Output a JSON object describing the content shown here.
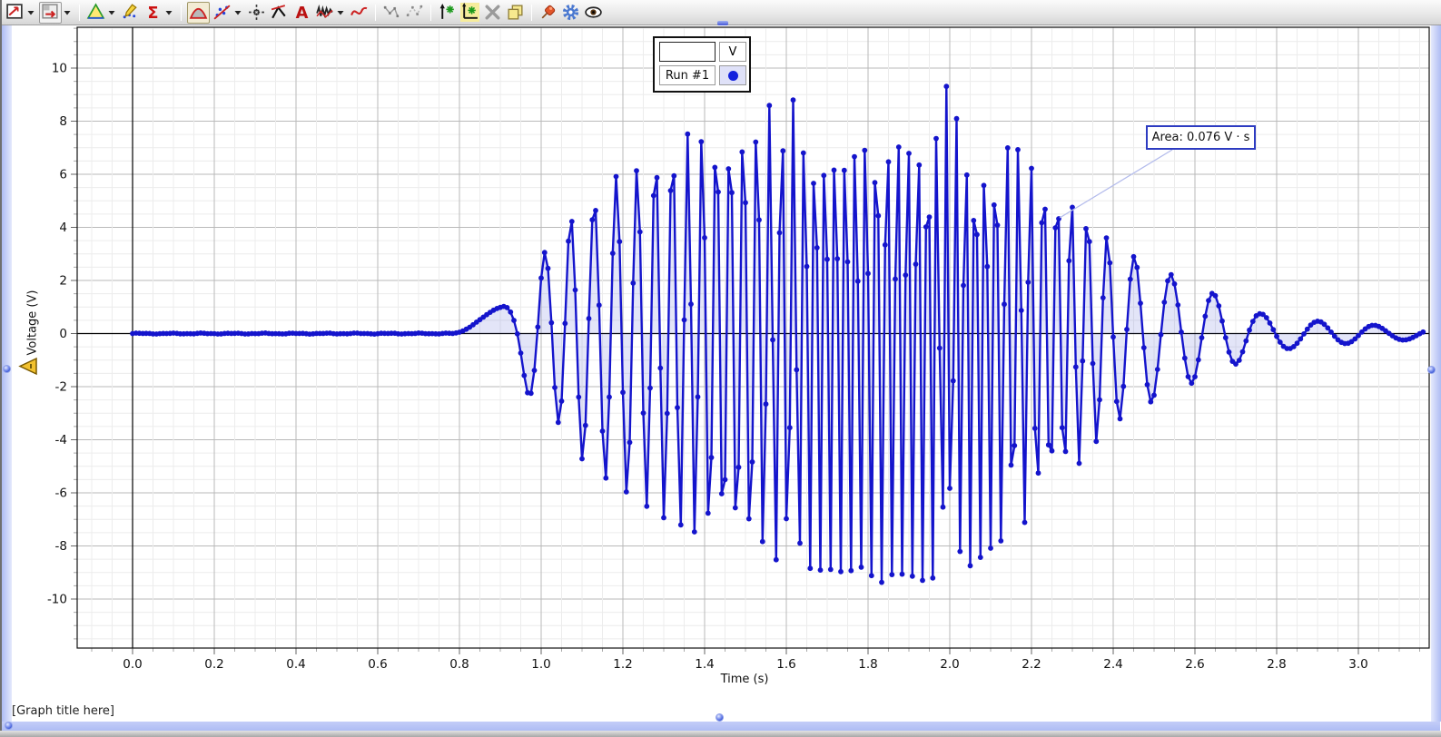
{
  "toolbar": {
    "buttons": [
      {
        "icon": "graph-display",
        "dropdown": true
      },
      {
        "icon": "scale-to-fit",
        "dropdown": true,
        "boxed": true
      },
      {
        "sep": true
      },
      {
        "icon": "prism",
        "dropdown": true
      },
      {
        "icon": "pencil-edit"
      },
      {
        "icon": "sigma",
        "dropdown": true
      },
      {
        "sep": true
      },
      {
        "icon": "area-tool",
        "active": true
      },
      {
        "icon": "curve-fit",
        "dropdown": true
      },
      {
        "icon": "smart-cursor"
      },
      {
        "icon": "tangent"
      },
      {
        "icon": "annotate"
      },
      {
        "icon": "noise-wave",
        "dropdown": true
      },
      {
        "icon": "sketch"
      },
      {
        "sep": true
      },
      {
        "icon": "link-points"
      },
      {
        "icon": "unlink-points"
      },
      {
        "sep": true
      },
      {
        "icon": "add-plot"
      },
      {
        "icon": "axes-tool",
        "highlight": true
      },
      {
        "icon": "remove-plot"
      },
      {
        "icon": "copy-display"
      },
      {
        "sep": true
      },
      {
        "icon": "pin"
      },
      {
        "icon": "settings-gear"
      },
      {
        "icon": "visibility-eye"
      }
    ]
  },
  "legend": {
    "value_header": "V",
    "run_label": "Run #1"
  },
  "annotation": {
    "text": "Area: 0.076 V · s"
  },
  "axis": {
    "x_label": "Time (s)",
    "y_label": "Voltage (V)",
    "title_placeholder": "[Graph title here]"
  },
  "chart_data": {
    "type": "line",
    "title": "",
    "xlabel": "Time (s)",
    "ylabel": "Voltage (V)",
    "series": [
      {
        "name": "Run #1",
        "color": "#1414cc",
        "marker": "dot"
      }
    ],
    "x_ticks": [
      "0.0",
      "0.2",
      "0.4",
      "0.6",
      "0.8",
      "1.0",
      "1.2",
      "1.4",
      "1.6",
      "1.8",
      "2.0",
      "2.2",
      "2.4",
      "2.6",
      "2.8",
      "3.0"
    ],
    "x_tick_values": [
      0.0,
      0.2,
      0.4,
      0.6,
      0.8,
      1.0,
      1.2,
      1.4,
      1.6,
      1.8,
      2.0,
      2.2,
      2.4,
      2.6,
      2.8,
      3.0
    ],
    "y_ticks": [
      -10,
      -8,
      -6,
      -4,
      -2,
      0,
      2,
      4,
      6,
      8,
      10
    ],
    "x_minor_step": 0.05,
    "y_minor_step": 0.5,
    "x_range": [
      -0.136,
      3.173
    ],
    "y_range": [
      -11.85,
      11.54
    ],
    "grid": true,
    "area_value_label": "Area: 0.076 V · s",
    "signal": {
      "description": "voltage burst: flat near 0 V until ~0.78 s, amplitude-modulated oscillation peaking ~9.5 V near 1.9 s, decaying ring-down to ~0.2 V by 3.16 s",
      "sample_rate_hz": 120,
      "t_start": 0.0,
      "t_end": 3.16,
      "envelope_keypoints": [
        [
          0,
          0
        ],
        [
          0.76,
          0
        ],
        [
          0.8,
          0.22
        ],
        [
          0.84,
          0.6
        ],
        [
          0.9,
          1.0
        ],
        [
          0.94,
          1.5
        ],
        [
          0.97,
          2.35
        ],
        [
          1.0,
          3.0
        ],
        [
          1.04,
          3.3
        ],
        [
          1.08,
          4.6
        ],
        [
          1.13,
          5.0
        ],
        [
          1.18,
          5.9
        ],
        [
          1.23,
          6.2
        ],
        [
          1.3,
          7.0
        ],
        [
          1.4,
          7.9
        ],
        [
          1.5,
          8.5
        ],
        [
          1.62,
          8.9
        ],
        [
          1.75,
          9.2
        ],
        [
          1.88,
          9.5
        ],
        [
          1.95,
          9.4
        ],
        [
          2.0,
          9.3
        ],
        [
          2.06,
          8.7
        ],
        [
          2.12,
          8.0
        ],
        [
          2.18,
          7.2
        ],
        [
          2.24,
          6.2
        ],
        [
          2.3,
          5.2
        ],
        [
          2.36,
          4.1
        ],
        [
          2.4,
          3.4
        ],
        [
          2.44,
          3.0
        ],
        [
          2.48,
          2.7
        ],
        [
          2.53,
          2.3
        ],
        [
          2.58,
          1.95
        ],
        [
          2.64,
          1.55
        ],
        [
          2.7,
          1.15
        ],
        [
          2.76,
          0.75
        ],
        [
          2.84,
          0.55
        ],
        [
          2.95,
          0.4
        ],
        [
          3.05,
          0.3
        ],
        [
          3.16,
          0.2
        ]
      ],
      "frequency_keypoints_hz": [
        [
          0.78,
          1.8
        ],
        [
          0.88,
          2.6
        ],
        [
          0.93,
          6
        ],
        [
          0.96,
          9.5
        ],
        [
          1.0,
          13
        ],
        [
          1.06,
          15.5
        ],
        [
          1.15,
          18
        ],
        [
          1.25,
          22
        ],
        [
          1.4,
          28
        ],
        [
          1.55,
          35
        ],
        [
          1.7,
          39.5
        ],
        [
          1.8,
          40.5
        ],
        [
          1.95,
          41.5
        ],
        [
          2.05,
          39.5
        ],
        [
          2.15,
          36
        ],
        [
          2.25,
          30
        ],
        [
          2.32,
          24
        ],
        [
          2.4,
          16
        ],
        [
          2.47,
          12.5
        ],
        [
          2.55,
          10.5
        ],
        [
          2.65,
          9
        ],
        [
          2.8,
          7.6
        ],
        [
          3.0,
          6.8
        ],
        [
          3.16,
          6.6
        ]
      ]
    }
  }
}
